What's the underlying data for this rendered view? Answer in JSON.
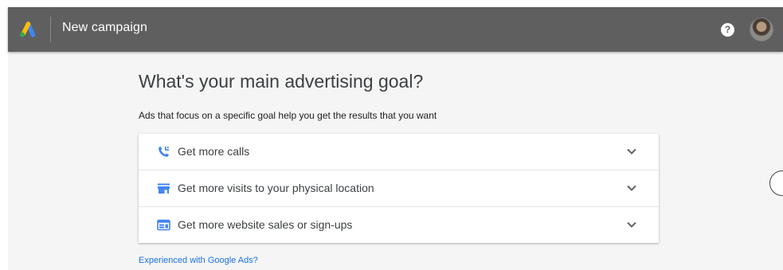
{
  "header": {
    "title": "New campaign",
    "logo_icon": "google-ads-logo-icon",
    "help_icon": "help-icon",
    "help_glyph": "?",
    "avatar_icon": "user-avatar"
  },
  "main": {
    "heading": "What's your main advertising goal?",
    "subtitle": "Ads that focus on a specific goal help you get the results that you want",
    "goals": [
      {
        "label": "Get more calls",
        "icon": "phone-icon"
      },
      {
        "label": "Get more visits to your physical location",
        "icon": "store-icon"
      },
      {
        "label": "Get more website sales or sign-ups",
        "icon": "web-icon"
      }
    ],
    "experienced_link": "Experienced with Google Ads?"
  },
  "colors": {
    "header_bg": "#5f5f5f",
    "content_bg": "#f5f5f5",
    "accent_blue": "#4285f4",
    "link_blue": "#1a73e8",
    "logo_yellow": "#fbbc04",
    "logo_green": "#34a853"
  }
}
